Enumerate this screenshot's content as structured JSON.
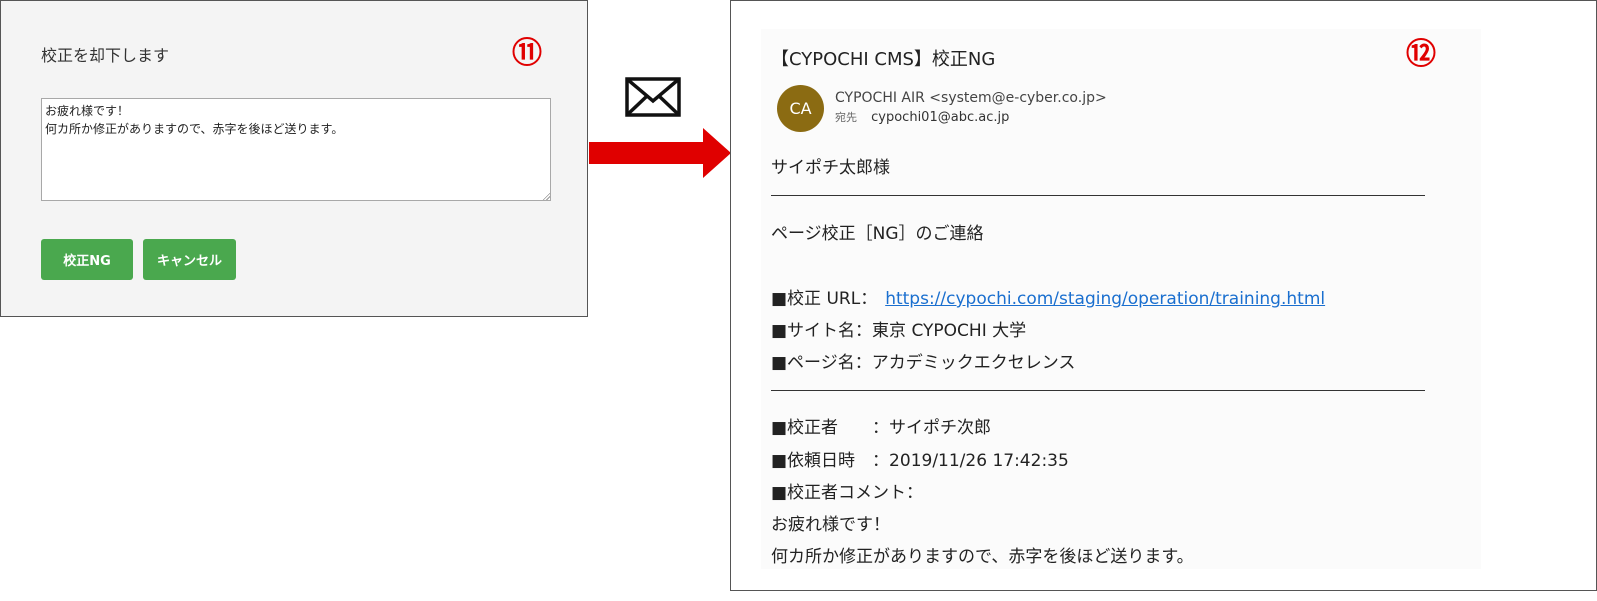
{
  "dialog": {
    "title": "校正を却下します",
    "step_badge": "⑪",
    "comment_text": "お疲れ様です！\n何カ所か修正がありますので、赤字を後ほど送ります。",
    "buttons": {
      "reject_label": "校正NG",
      "cancel_label": "キャンセル"
    },
    "button_color": "#4aa84e"
  },
  "middle": {
    "envelope_icon": "mail-envelope-icon",
    "arrow_icon": "right-arrow-icon",
    "arrow_color": "#e00000"
  },
  "email": {
    "step_badge": "⑫",
    "subject": "【CYPOCHI CMS】校正NG",
    "avatar_initials": "CA",
    "avatar_color": "#8b6b12",
    "sender": "CYPOCHI AIR <system@e-cyber.co.jp>",
    "to_label": "宛先",
    "to_address": "cypochi01@abc.ac.jp",
    "greeting": "サイポチ太郎様",
    "divider": "——————————————————————————————————————",
    "notice": "ページ校正［NG］のご連絡",
    "url_label": "■校正 URL：",
    "url": "https://cypochi.com/staging/operation/training.html",
    "site_name": "■サイト名：東京 CYPOCHI 大学",
    "page_name": "■ページ名：アカデミックエクセレンス",
    "reviewer": "■校正者　　：サイポチ次郎",
    "request_datetime": "■依頼日時　：2019/11/26 17:42:35",
    "reviewer_comment_label": "■校正者コメント：",
    "comment_line1": "お疲れ様です！",
    "comment_line2": "何カ所か修正がありますので、赤字を後ほど送ります。"
  }
}
